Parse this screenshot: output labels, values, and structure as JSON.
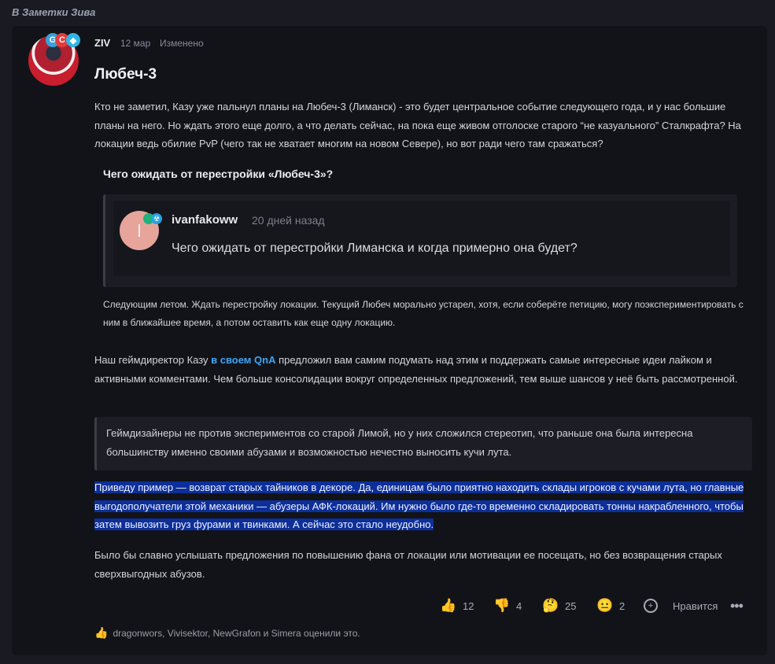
{
  "breadcrumb": "В Заметки Зива",
  "post": {
    "author": "ZIV",
    "date": "12 мар",
    "edited": "Изменено",
    "title": "Любеч-3",
    "paragraph1": "Кто не заметил, Казу уже пальнул планы на Любеч-3 (Лиманск) - это будет центральное событие следующего года, и у нас большие планы на него. Но ждать этого еще долго, а что делать сейчас, на пока еще живом отголоске старого “не казуального” Сталкрафта? На локации ведь обилие PvP (чего так не хватает многим на новом Севере), но вот ради чего там сражаться?",
    "quote_header": "Чего ожидать от перестройки «Любеч-3»?",
    "embed": {
      "username": "ivanfakoww",
      "age": "20 дней назад",
      "text": "Чего ожидать от перестройки Лиманска и когда примерно она будет?"
    },
    "answer": "Следующим летом. Ждать перестройку локации. Текущий Любеч морально устарел, хотя, если соберёте петицию, могу поэкспериментировать с ним в ближайшее время, а потом оставить как еще одну локацию.",
    "paragraph2_before": "Наш геймдиректор Казу ",
    "paragraph2_link": "в своем QnA",
    "paragraph2_after": " предложил вам самим подумать над этим и поддержать самые интересные идеи лайком и активными комментами. Чем больше консолидации вокруг определенных предложений, тем выше шансов у неё быть рассмотренной.",
    "blockquote": "Геймдизайнеры не против экспериментов со старой Лимой, но у них сложился стереотип, что раньше она была интересна большинству именно своими абузами и возможностью нечестно выносить кучи лута.",
    "paragraph3_selected": "Приведу пример — возврат старых тайников в декоре. Да, единицам было приятно находить склады игроков с кучами лута, но главные выгодополучатели этой механики — абузеры АФК-локаций. Им нужно было где-то временно складировать тонны накрабленного, чтобы затем вывозить груз фурами и твинками. А сейчас это стало неудобно.",
    "paragraph4": "Было бы славно услышать предложения по повышению фана от локации или мотивации ее посещать, но без возвращения старых сверхвыгодных абузов."
  },
  "reactions": {
    "thumbs_up": "12",
    "thumbs_down": "4",
    "thinking": "25",
    "neutral": "2",
    "like_label": "Нравится"
  },
  "liked_by": "dragonwors, Vivisektor, NewGrafon и Simera оценили это.",
  "icons": [
    "thumbs-up-icon",
    "thumbs-down-icon",
    "thinking-face-icon",
    "neutral-face-icon",
    "add-reaction-icon",
    "more-icon",
    "like-thumb-icon"
  ],
  "colors": {
    "link": "#3fa4f5",
    "selection": "#0d2f99",
    "background": "#121319"
  }
}
